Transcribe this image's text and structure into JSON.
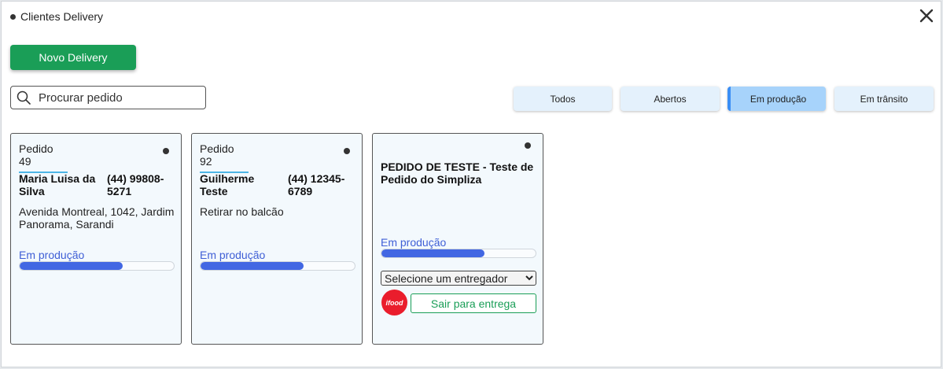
{
  "window": {
    "title": "Clientes Delivery"
  },
  "toolbar": {
    "new_label": "Novo Delivery"
  },
  "search": {
    "placeholder": "Procurar pedido"
  },
  "filters": [
    "Todos",
    "Abertos",
    "Em produção",
    "Em trânsito"
  ],
  "active_filter": "Em produção",
  "orders": [
    {
      "label": "Pedido 49",
      "name": "Maria Luisa da Silva",
      "phone": "(44) 99808-5271",
      "address": "Avenida Montreal, 1042, Jardim Panorama, Sarandi",
      "status": "Em produção",
      "progress": 0.67
    },
    {
      "label": "Pedido 92",
      "name": "Guilherme Teste",
      "phone": "(44) 12345-6789",
      "address": "Retirar no balcão",
      "status": "Em produção",
      "progress": 0.67
    },
    {
      "title": "PEDIDO DE TESTE - Teste de Pedido do Simpliza",
      "status": "Em produção",
      "progress": 0.67,
      "select_value": "Selecione um entregador",
      "ifood_label": "ifood",
      "action_label": "Sair para entrega"
    }
  ],
  "colors": {
    "primary": "#1a9e57",
    "accent": "#4267e3",
    "filter_active": "#a7d3fb",
    "ifood": "#ea1d2c"
  }
}
